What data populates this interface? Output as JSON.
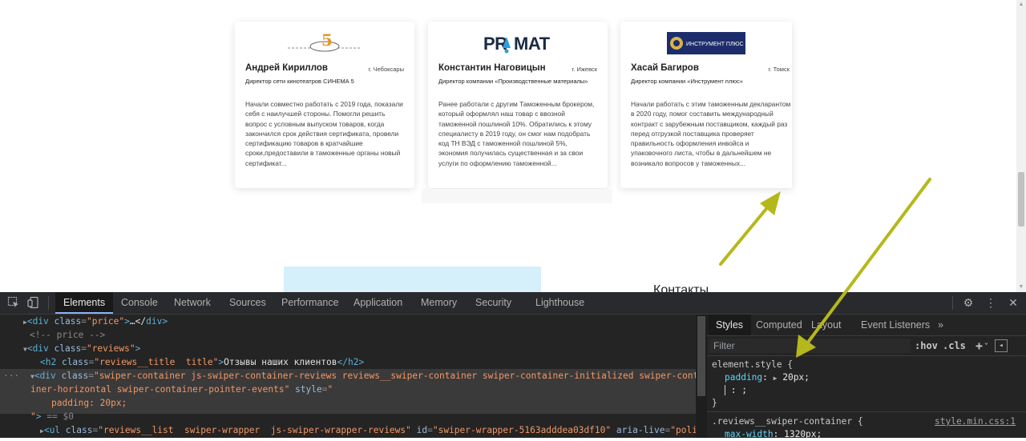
{
  "reviews": [
    {
      "name": "Андрей Кириллов",
      "city": "г. Чебоксары",
      "role": "Директор сети кинотеатров СИНЕМА 5",
      "text": "Начали совместно работать с 2019 года, показали себя с наилучшей стороны. Помогли решить вопрос с условным выпуском товаров, когда закончился срок действия сертификата, провели сертификацию товаров в кратчайшие сроки,предоставили в таможенные органы новый сертификат...",
      "logo_text": "Cinema"
    },
    {
      "name": "Константин Наговицын",
      "city": "г. Ижевск",
      "role": "Директор компании «Производственные материалы»",
      "text": "Ранее работали с другим Таможенным брокером, который оформлял наш товар с ввозной таможенной пошлиной 10%. Обратились к этому специалисту в 2019 году, он смог нам подобрать код ТН ВЭД с таможенной пошлиной 5%, экономия получилась существенная и за свои услуги по оформлению таможенной...",
      "logo_text": "PRAMAT"
    },
    {
      "name": "Хасай Багиров",
      "city": "г. Томск",
      "role": "Директор компании «Инструмент плюс»",
      "text": "Начали работать с этим таможенным декларантом в 2020 году, помог составить международный контракт с зарубежным поставщиком, каждый раз перед отгрузкой поставщика проверяет правильность оформления инвойса и упаковочного листа, чтобы в дальнейшем не возникало вопросов у таможенных...",
      "logo_text": "ИНСТРУМЕНТ ПЛЮС"
    }
  ],
  "contacts_label": "Контакты",
  "devtools": {
    "tabs": [
      "Elements",
      "Console",
      "Network",
      "Sources",
      "Performance",
      "Application",
      "Memory",
      "Security",
      "Lighthouse"
    ],
    "elements": {
      "line1_tag": "div",
      "line1_attr": "class",
      "line1_val": "\"price\"",
      "line1_rest": "…</",
      "line2": "<!-- price -->",
      "line3_val": "\"reviews\"",
      "line4_val": "\"reviews__title  title\"",
      "line4_text": "Отзывы наших клиентов",
      "line5_val": "\"swiper-container js-swiper-container-reviews reviews__swiper-container swiper-container-initialized swiper-conta",
      "line6_val": "iner-horizontal swiper-container-pointer-events\"",
      "line6_attr2": "style",
      "line7": "padding: 20px;",
      "line8": "== $0",
      "line9_val": "\"reviews__list  swiper-wrapper  js-swiper-wrapper-reviews\"",
      "line9_id": "\"swiper-wrapper-5163adddea03df10\"",
      "line9_aria": "aria-live",
      "line9_aria_val": "\"polit"
    },
    "styles": {
      "tabs": [
        "Styles",
        "Computed",
        "Layout",
        "Event Listeners"
      ],
      "filter_placeholder": "Filter",
      "hov": ":hov",
      "cls": ".cls",
      "rule1_selector": "element.style {",
      "rule1_prop": "padding",
      "rule1_val": "20px;",
      "rule1_extra": ": ;",
      "rule1_close": "}",
      "rule2_selector": ".reviews__swiper-container {",
      "rule2_source": "style.min.css:1",
      "rule2_prop": "max-width",
      "rule2_val": "1320px;"
    }
  },
  "colors": {
    "arrow": "#b5b81a",
    "devtools_bg": "#242424",
    "selected_row": "#3a3a3a",
    "blue_box": "#d5f0fb"
  }
}
